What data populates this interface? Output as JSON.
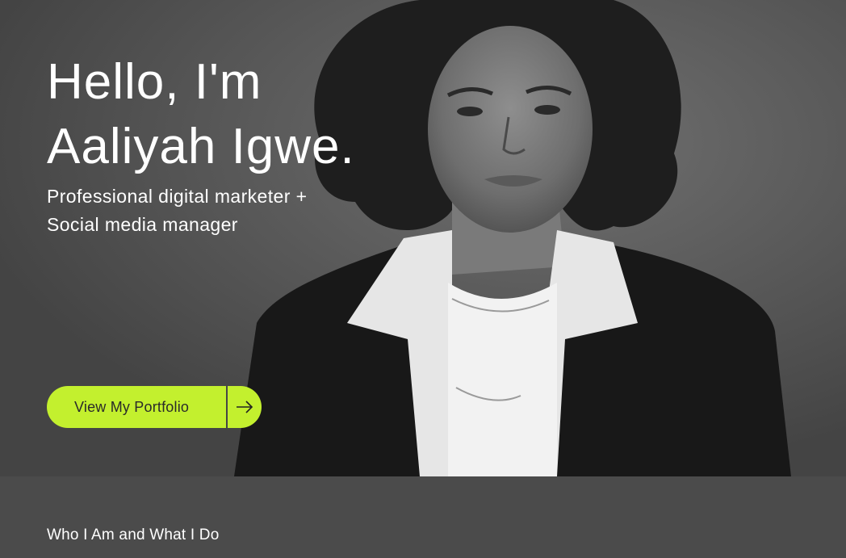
{
  "hero": {
    "title_line1": "Hello, I'm",
    "title_line2": "Aaliyah Igwe.",
    "subtitle_line1": "Professional digital marketer +",
    "subtitle_line2": "Social media manager",
    "cta_label": "View My Portfolio",
    "cta_icon": "arrow-right-icon"
  },
  "about": {
    "heading": "Who I Am and What I Do"
  },
  "colors": {
    "accent": "#c3f02e",
    "hero_background": "#575757",
    "section_background": "#4b4b4b",
    "text": "#ffffff"
  }
}
